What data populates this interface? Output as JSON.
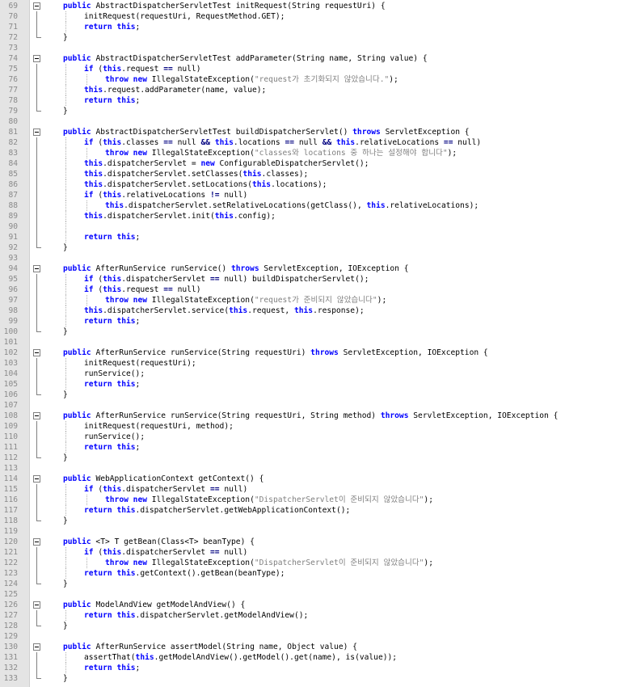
{
  "editor": {
    "colors": {
      "keyword": "#0000ff",
      "string": "#808080",
      "operator": "#000080",
      "line_number": "#8a8a8a",
      "gutter_bg": "#e4e4e4"
    },
    "lines": [
      {
        "n": "69",
        "ind": 0,
        "fold": "open",
        "code": "public AbstractDispatcherServletTest initRequest(String requestUri) {"
      },
      {
        "n": "70",
        "ind": 1,
        "fold": "line",
        "code": "initRequest(requestUri, RequestMethod.GET);"
      },
      {
        "n": "71",
        "ind": 1,
        "fold": "line",
        "code": "return this;"
      },
      {
        "n": "72",
        "ind": 0,
        "fold": "end",
        "code": "}"
      },
      {
        "n": "73",
        "ind": 0,
        "fold": "",
        "code": ""
      },
      {
        "n": "74",
        "ind": 0,
        "fold": "open",
        "code": "public AbstractDispatcherServletTest addParameter(String name, String value) {"
      },
      {
        "n": "75",
        "ind": 1,
        "fold": "line",
        "code": "if (this.request == null)"
      },
      {
        "n": "76",
        "ind": 2,
        "fold": "line",
        "code": "throw new IllegalStateException(\"request가 초기화되지 않았습니다.\");"
      },
      {
        "n": "77",
        "ind": 1,
        "fold": "line",
        "code": "this.request.addParameter(name, value);"
      },
      {
        "n": "78",
        "ind": 1,
        "fold": "line",
        "code": "return this;"
      },
      {
        "n": "79",
        "ind": 0,
        "fold": "end",
        "code": "}"
      },
      {
        "n": "80",
        "ind": 0,
        "fold": "",
        "code": ""
      },
      {
        "n": "81",
        "ind": 0,
        "fold": "open",
        "code": "public AbstractDispatcherServletTest buildDispatcherServlet() throws ServletException {"
      },
      {
        "n": "82",
        "ind": 1,
        "fold": "line",
        "code": "if (this.classes == null && this.locations == null && this.relativeLocations == null)"
      },
      {
        "n": "83",
        "ind": 2,
        "fold": "line",
        "code": "throw new IllegalStateException(\"classes와 locations 중 하나는 설정해야 합니다\");"
      },
      {
        "n": "84",
        "ind": 1,
        "fold": "line",
        "code": "this.dispatcherServlet = new ConfigurableDispatcherServlet();"
      },
      {
        "n": "85",
        "ind": 1,
        "fold": "line",
        "code": "this.dispatcherServlet.setClasses(this.classes);"
      },
      {
        "n": "86",
        "ind": 1,
        "fold": "line",
        "code": "this.dispatcherServlet.setLocations(this.locations);"
      },
      {
        "n": "87",
        "ind": 1,
        "fold": "line",
        "code": "if (this.relativeLocations != null)"
      },
      {
        "n": "88",
        "ind": 2,
        "fold": "line",
        "code": "this.dispatcherServlet.setRelativeLocations(getClass(), this.relativeLocations);"
      },
      {
        "n": "89",
        "ind": 1,
        "fold": "line",
        "code": "this.dispatcherServlet.init(this.config);"
      },
      {
        "n": "90",
        "ind": 1,
        "fold": "line",
        "code": ""
      },
      {
        "n": "91",
        "ind": 1,
        "fold": "line",
        "code": "return this;"
      },
      {
        "n": "92",
        "ind": 0,
        "fold": "end",
        "code": "}"
      },
      {
        "n": "93",
        "ind": 0,
        "fold": "",
        "code": ""
      },
      {
        "n": "94",
        "ind": 0,
        "fold": "open",
        "code": "public AfterRunService runService() throws ServletException, IOException {"
      },
      {
        "n": "95",
        "ind": 1,
        "fold": "line",
        "code": "if (this.dispatcherServlet == null) buildDispatcherServlet();"
      },
      {
        "n": "96",
        "ind": 1,
        "fold": "line",
        "code": "if (this.request == null)"
      },
      {
        "n": "97",
        "ind": 2,
        "fold": "line",
        "code": "throw new IllegalStateException(\"request가 준비되지 않았습니다\");"
      },
      {
        "n": "98",
        "ind": 1,
        "fold": "line",
        "code": "this.dispatcherServlet.service(this.request, this.response);"
      },
      {
        "n": "99",
        "ind": 1,
        "fold": "line",
        "code": "return this;"
      },
      {
        "n": "100",
        "ind": 0,
        "fold": "end",
        "code": "}"
      },
      {
        "n": "101",
        "ind": 0,
        "fold": "",
        "code": ""
      },
      {
        "n": "102",
        "ind": 0,
        "fold": "open",
        "code": "public AfterRunService runService(String requestUri) throws ServletException, IOException {"
      },
      {
        "n": "103",
        "ind": 1,
        "fold": "line",
        "code": "initRequest(requestUri);"
      },
      {
        "n": "104",
        "ind": 1,
        "fold": "line",
        "code": "runService();"
      },
      {
        "n": "105",
        "ind": 1,
        "fold": "line",
        "code": "return this;"
      },
      {
        "n": "106",
        "ind": 0,
        "fold": "end",
        "code": "}"
      },
      {
        "n": "107",
        "ind": 0,
        "fold": "",
        "code": ""
      },
      {
        "n": "108",
        "ind": 0,
        "fold": "open",
        "code": "public AfterRunService runService(String requestUri, String method) throws ServletException, IOException {"
      },
      {
        "n": "109",
        "ind": 1,
        "fold": "line",
        "code": "initRequest(requestUri, method);"
      },
      {
        "n": "110",
        "ind": 1,
        "fold": "line",
        "code": "runService();"
      },
      {
        "n": "111",
        "ind": 1,
        "fold": "line",
        "code": "return this;"
      },
      {
        "n": "112",
        "ind": 0,
        "fold": "end",
        "code": "}"
      },
      {
        "n": "113",
        "ind": 0,
        "fold": "",
        "code": ""
      },
      {
        "n": "114",
        "ind": 0,
        "fold": "open",
        "code": "public WebApplicationContext getContext() {"
      },
      {
        "n": "115",
        "ind": 1,
        "fold": "line",
        "code": "if (this.dispatcherServlet == null)"
      },
      {
        "n": "116",
        "ind": 2,
        "fold": "line",
        "code": "throw new IllegalStateException(\"DispatcherServlet이 준비되지 않았습니다\");"
      },
      {
        "n": "117",
        "ind": 1,
        "fold": "line",
        "code": "return this.dispatcherServlet.getWebApplicationContext();"
      },
      {
        "n": "118",
        "ind": 0,
        "fold": "end",
        "code": "}"
      },
      {
        "n": "119",
        "ind": 0,
        "fold": "",
        "code": ""
      },
      {
        "n": "120",
        "ind": 0,
        "fold": "open",
        "code": "public <T> T getBean(Class<T> beanType) {"
      },
      {
        "n": "121",
        "ind": 1,
        "fold": "line",
        "code": "if (this.dispatcherServlet == null)"
      },
      {
        "n": "122",
        "ind": 2,
        "fold": "line",
        "code": "throw new IllegalStateException(\"DispatcherServlet이 준비되지 않았습니다\");"
      },
      {
        "n": "123",
        "ind": 1,
        "fold": "line",
        "code": "return this.getContext().getBean(beanType);"
      },
      {
        "n": "124",
        "ind": 0,
        "fold": "end",
        "code": "}"
      },
      {
        "n": "125",
        "ind": 0,
        "fold": "",
        "code": ""
      },
      {
        "n": "126",
        "ind": 0,
        "fold": "open",
        "code": "public ModelAndView getModelAndView() {"
      },
      {
        "n": "127",
        "ind": 1,
        "fold": "line",
        "code": "return this.dispatcherServlet.getModelAndView();"
      },
      {
        "n": "128",
        "ind": 0,
        "fold": "end",
        "code": "}"
      },
      {
        "n": "129",
        "ind": 0,
        "fold": "",
        "code": ""
      },
      {
        "n": "130",
        "ind": 0,
        "fold": "open",
        "code": "public AfterRunService assertModel(String name, Object value) {"
      },
      {
        "n": "131",
        "ind": 1,
        "fold": "line",
        "code": "assertThat(this.getModelAndView().getModel().get(name), is(value));"
      },
      {
        "n": "132",
        "ind": 1,
        "fold": "line",
        "code": "return this;"
      },
      {
        "n": "133",
        "ind": 0,
        "fold": "end",
        "code": "}"
      }
    ]
  }
}
